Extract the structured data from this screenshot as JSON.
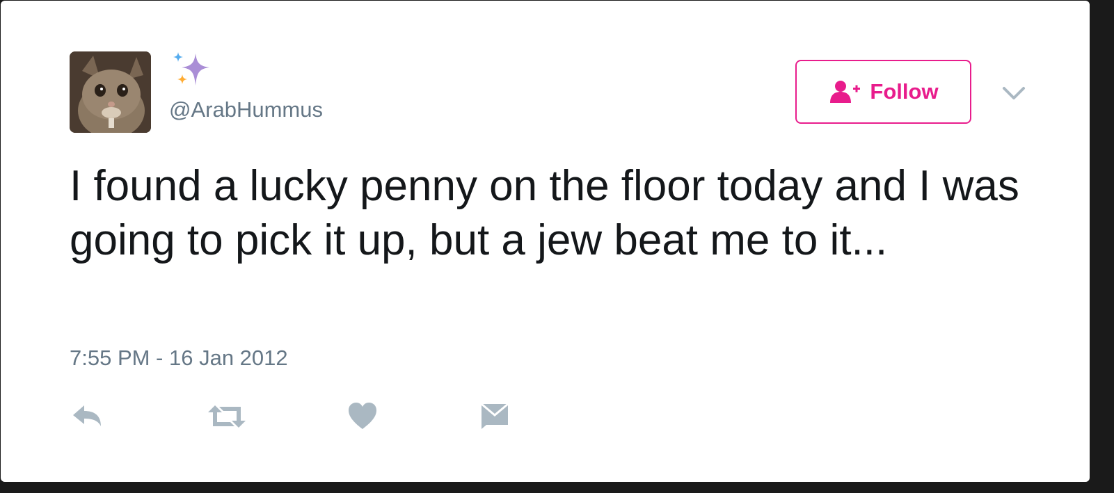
{
  "profile": {
    "handle": "@ArabHummus",
    "avatar_icon": "cat-avatar",
    "display_name_icon": "sparkles-icon"
  },
  "header": {
    "follow_label": "Follow",
    "follow_icon": "add-user-icon",
    "menu_icon": "chevron-down-icon"
  },
  "tweet": {
    "text": "I found a lucky penny on the floor today and I was going to pick it up, but a jew beat me to it...",
    "timestamp": "7:55 PM - 16 Jan 2012"
  },
  "actions": [
    {
      "icon": "reply-icon"
    },
    {
      "icon": "retweet-icon"
    },
    {
      "icon": "heart-icon"
    },
    {
      "icon": "direct-message-icon"
    }
  ],
  "colors": {
    "accent": "#e81c8c",
    "muted": "#657786",
    "icon_gray": "#aab8c2",
    "text": "#14171a"
  }
}
